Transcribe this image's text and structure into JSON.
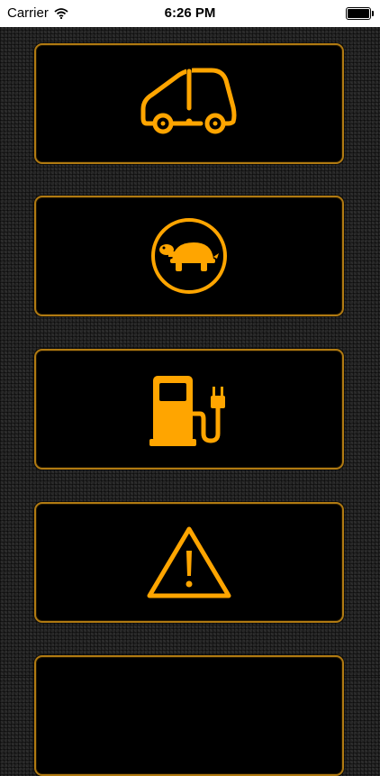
{
  "status_bar": {
    "carrier": "Carrier",
    "time": "6:26 PM"
  },
  "warnings": [
    {
      "icon": "vehicle-fault-icon"
    },
    {
      "icon": "turtle-reduced-power-icon"
    },
    {
      "icon": "charging-station-icon"
    },
    {
      "icon": "warning-triangle-icon"
    },
    {
      "icon": "partially-visible-card"
    }
  ],
  "colors": {
    "icon_amber": "#ffa500",
    "card_border": "#b07a12",
    "card_background": "#000000",
    "page_background": "#262626"
  }
}
